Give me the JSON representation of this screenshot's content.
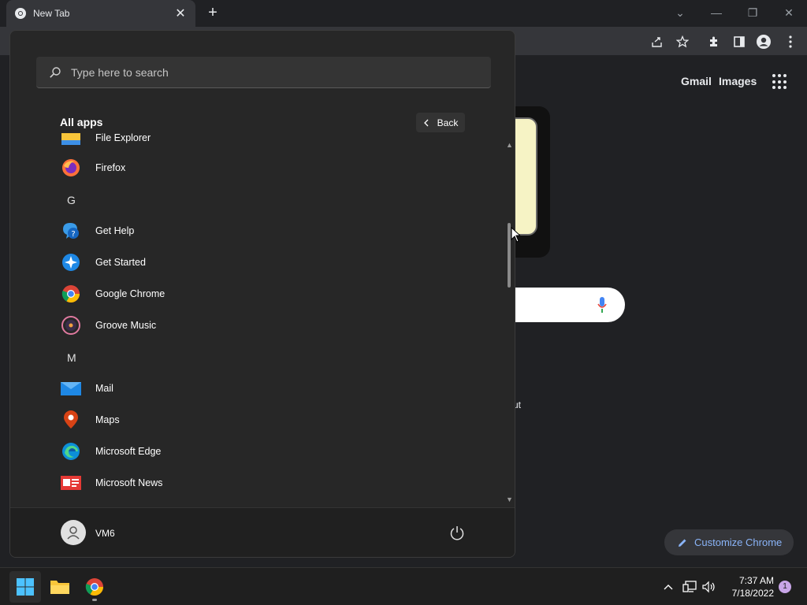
{
  "chrome": {
    "tab_title": "New Tab",
    "tab_close": "✕",
    "new_tab": "+",
    "minimize": "—",
    "restore": "❐",
    "close": "✕",
    "dropdown": "⌄",
    "links": {
      "gmail": "Gmail",
      "images": "Images"
    },
    "partial_text": "ut",
    "customize_label": "Customize Chrome"
  },
  "start_menu": {
    "search_placeholder": "Type here to search",
    "all_apps_title": "All apps",
    "back_label": "Back",
    "partial_item": "File Explorer",
    "apps": [
      {
        "label": "Firefox",
        "icon": "firefox-icon"
      },
      {
        "header": "G"
      },
      {
        "label": "Get Help",
        "icon": "get-help-icon"
      },
      {
        "label": "Get Started",
        "icon": "get-started-icon"
      },
      {
        "label": "Google Chrome",
        "icon": "chrome-icon"
      },
      {
        "label": "Groove Music",
        "icon": "groove-music-icon"
      },
      {
        "header": "M"
      },
      {
        "label": "Mail",
        "icon": "mail-icon"
      },
      {
        "label": "Maps",
        "icon": "maps-icon"
      },
      {
        "label": "Microsoft Edge",
        "icon": "edge-icon"
      },
      {
        "label": "Microsoft News",
        "icon": "news-icon"
      }
    ],
    "user_name": "VM6"
  },
  "taskbar": {
    "time": "7:37 AM",
    "date": "7/18/2022",
    "notification_count": "1"
  },
  "colors": {
    "chrome_bg": "#202124",
    "start_bg": "#272727",
    "accent_blue": "#8ab4f8",
    "taskbar_bg": "#1f1f1f"
  }
}
